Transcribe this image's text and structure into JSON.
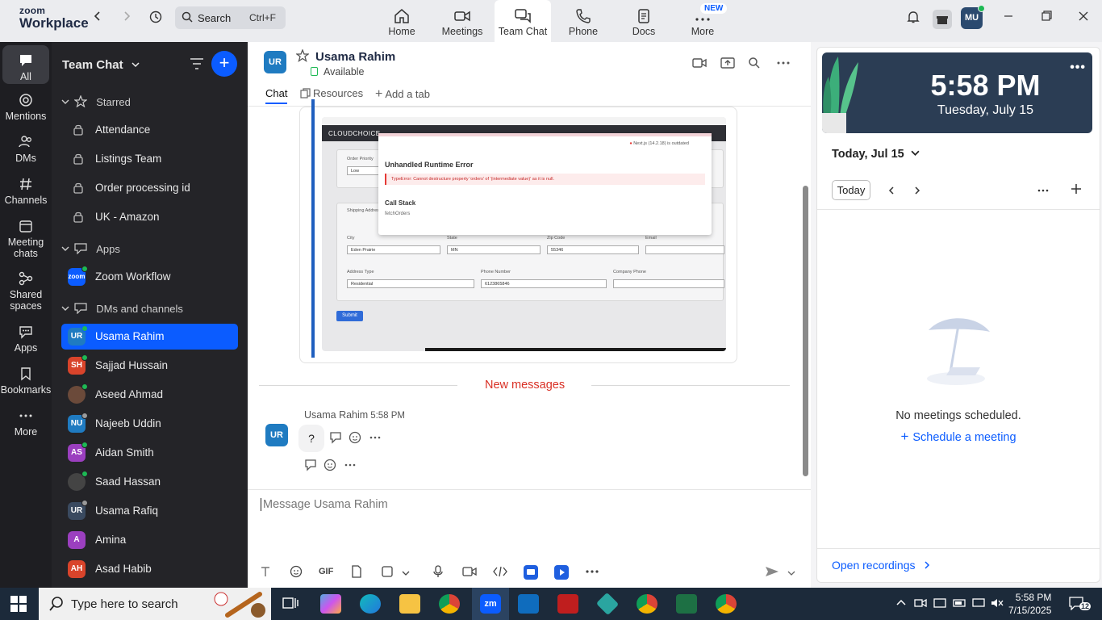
{
  "topbar": {
    "logo_line1": "zoom",
    "logo_line2": "Workplace",
    "search_label": "Search",
    "search_shortcut": "Ctrl+F",
    "tabs": [
      {
        "label": "Home"
      },
      {
        "label": "Meetings"
      },
      {
        "label": "Team Chat"
      },
      {
        "label": "Phone"
      },
      {
        "label": "Docs"
      },
      {
        "label": "More"
      }
    ],
    "new_badge": "NEW",
    "user_initials": "MU"
  },
  "rail": {
    "items": [
      {
        "label": "All",
        "icon": "chat-bubble-icon"
      },
      {
        "label": "Mentions",
        "icon": "at-icon"
      },
      {
        "label": "DMs",
        "icon": "people-icon"
      },
      {
        "label": "Channels",
        "icon": "hash-icon"
      },
      {
        "label": "Meeting chats",
        "icon": "calendar-icon"
      },
      {
        "label": "Shared spaces",
        "icon": "share-icon"
      },
      {
        "label": "Apps",
        "icon": "apps-icon"
      },
      {
        "label": "Bookmarks",
        "icon": "bookmark-icon"
      },
      {
        "label": "More",
        "icon": "more-icon"
      }
    ]
  },
  "list": {
    "title": "Team Chat",
    "sections": {
      "starred": "Starred",
      "apps": "Apps",
      "dms": "DMs and channels"
    },
    "starred_items": [
      "Attendance",
      "Listings Team",
      "Order processing id",
      "UK - Amazon"
    ],
    "apps_items": [
      {
        "name": "Zoom Workflow",
        "initials": "zoom"
      }
    ],
    "dm_items": [
      {
        "name": "Usama Rahim",
        "initials": "UR",
        "color": "#1f7bc1",
        "status": "#1db954"
      },
      {
        "name": "Sajjad Hussain",
        "initials": "SH",
        "color": "#d9442b",
        "status": "#1db954"
      },
      {
        "name": "Aseed Ahmad",
        "initials": "",
        "color": "#6b4a3a",
        "status": "#1db954"
      },
      {
        "name": "Najeeb Uddin",
        "initials": "NU",
        "color": "#1f7bc1",
        "status": "#9a9a9a"
      },
      {
        "name": "Aidan Smith",
        "initials": "AS",
        "color": "#9b3fbf",
        "status": "#1db954"
      },
      {
        "name": "Saad Hassan",
        "initials": "",
        "color": "#444444",
        "status": "#1db954"
      },
      {
        "name": "Usama Rafiq",
        "initials": "UR",
        "color": "#3a4a60",
        "status": "#9a9a9a"
      },
      {
        "name": "Amina",
        "initials": "A",
        "color": "#9b3fbf",
        "status": ""
      },
      {
        "name": "Asad Habib",
        "initials": "AH",
        "color": "#d9442b",
        "status": ""
      }
    ]
  },
  "chat": {
    "contact_initials": "UR",
    "contact_name": "Usama Rahim",
    "contact_status": "Available",
    "tabs": [
      "Chat",
      "Resources",
      "Add a tab"
    ],
    "new_messages_label": "New messages",
    "message": {
      "sender": "Usama Rahim",
      "time": "5:58 PM",
      "text": "?"
    },
    "compose_placeholder": "Message Usama Rahim",
    "screenshot": {
      "app_name": "CLOUDCHOICE",
      "error_title": "Unhandled Runtime Error",
      "error_text": "TypeError: Cannot destructure property 'orders' of '(intermediate value)' as it is null.",
      "call_stack": "Call Stack",
      "call_stack_fn": "fetchOrders",
      "next_status": "Next.js (14.2.18) is outdated",
      "labels": {
        "city": "City",
        "state": "State",
        "zip": "Zip Code",
        "email": "Email",
        "address_type": "Address Type",
        "phone": "Phone Number",
        "company_phone": "Company Phone",
        "order_priority": "Order Priority",
        "shipping": "Shipping Address"
      },
      "values": {
        "city": "Eden Prairie",
        "state": "MN",
        "zip": "55346",
        "address_type": "Residential",
        "phone": "6123865846",
        "priority": "Low"
      },
      "submit": "Submit"
    }
  },
  "calendar": {
    "time": "5:58 PM",
    "date": "Tuesday, July 15",
    "today_header": "Today, Jul 15",
    "today_button": "Today",
    "no_meetings": "No meetings scheduled.",
    "schedule": "Schedule a meeting",
    "open_recordings": "Open recordings"
  },
  "taskbar": {
    "search_placeholder": "Type here to search",
    "clock_time": "5:58 PM",
    "clock_date": "7/15/2025",
    "notifications": "12"
  }
}
